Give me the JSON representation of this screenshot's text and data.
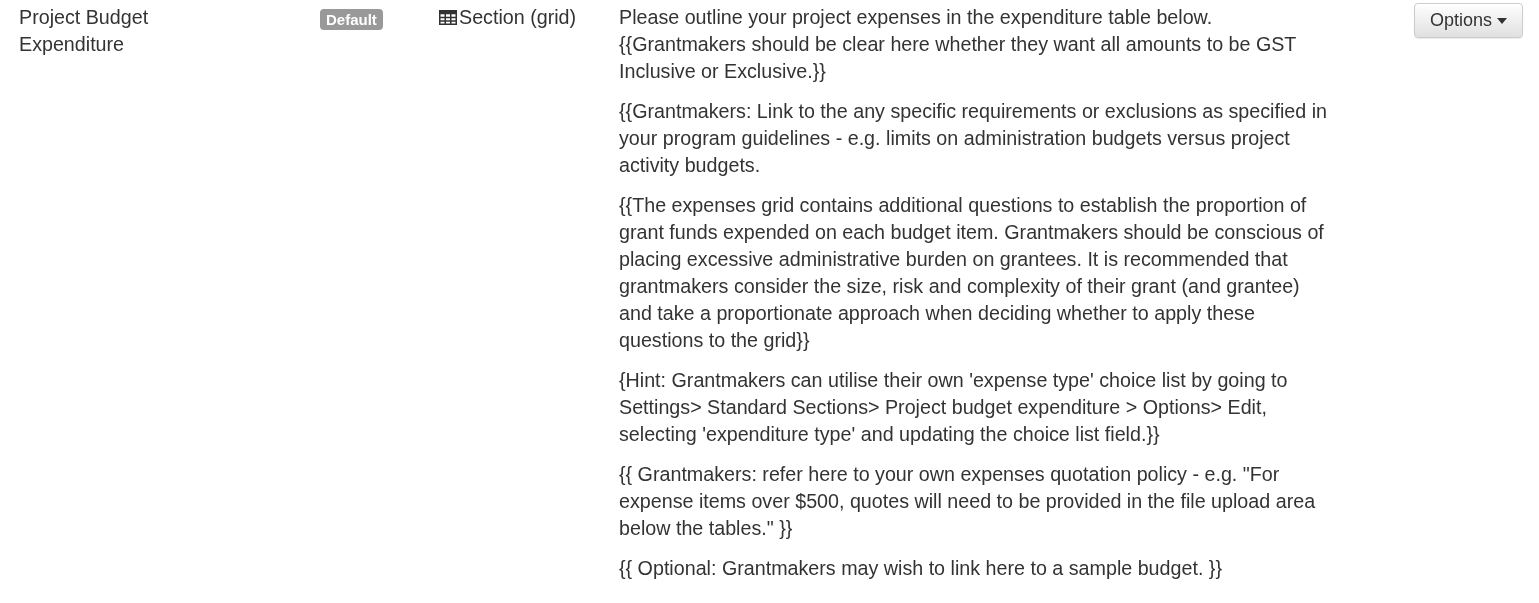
{
  "row": {
    "name": "Project Budget Expenditure",
    "badge": "Default",
    "type_label": "Section (grid)",
    "paragraphs": [
      [
        "Please outline your project expenses in the expenditure table below.",
        "{{Grantmakers should be clear here whether they want all amounts to be GST Inclusive or Exclusive.}}"
      ],
      [
        "{{Grantmakers: Link to the any specific requirements or exclusions as specified in your program guidelines - e.g. limits on administration budgets versus project activity budgets."
      ],
      [
        "{{The expenses grid contains additional questions to establish the proportion of grant funds expended on each budget item. Grantmakers should be conscious of placing excessive administrative burden on grantees. It is recommended that grantmakers consider the size, risk and complexity of their grant (and grantee) and take a proportionate approach when deciding whether to apply these questions to the grid}}"
      ],
      [
        "{Hint: Grantmakers can utilise their own 'expense type' choice list by going to Settings> Standard Sections> Project budget expenditure > Options> Edit, selecting 'expenditure type' and updating the choice list field.}}"
      ],
      [
        "{{ Grantmakers: refer here to your own expenses quotation policy - e.g. \"For expense items over $500, quotes will need to be provided in the file upload area below the tables.\" }}"
      ],
      [
        "{{ Optional: Grantmakers may wish to link here to a sample budget. }}"
      ]
    ],
    "options_button": "Options"
  }
}
